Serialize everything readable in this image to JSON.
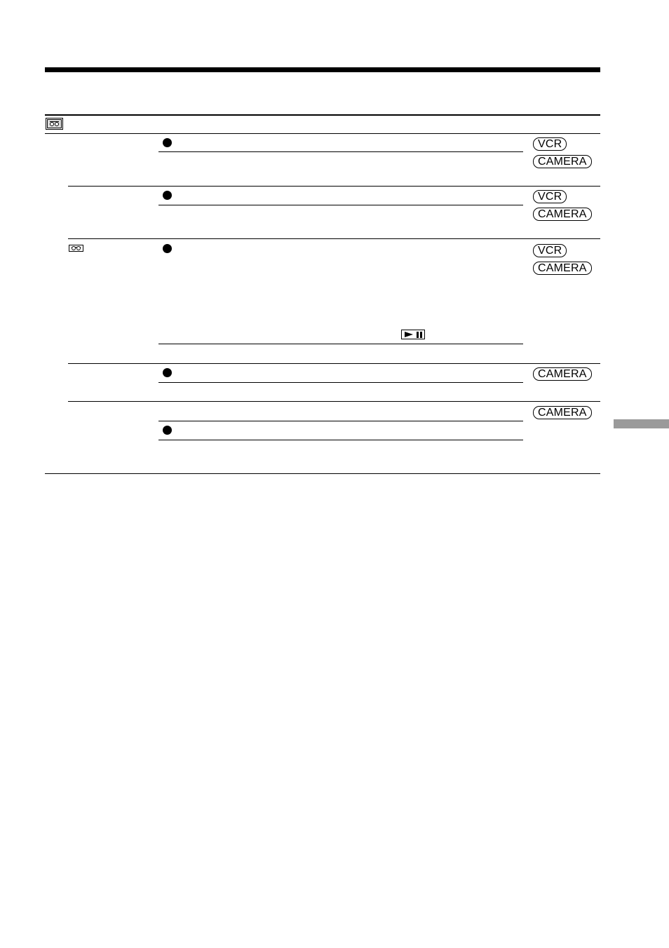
{
  "page": {
    "section_header_icon": "cassette-tape-icon",
    "side_tab": "chapter-index-tab"
  },
  "table": {
    "header": {
      "icon": "cassette-tape-icon"
    },
    "rows": [
      {
        "item_icon": null,
        "options": [
          {
            "bullet": "default-dot-icon"
          },
          {
            "bullet": null
          }
        ],
        "modes": [
          "VCR",
          "CAMERA"
        ]
      },
      {
        "item_icon": null,
        "options": [
          {
            "bullet": "default-dot-icon"
          },
          {
            "bullet": null
          }
        ],
        "modes": [
          "VCR",
          "CAMERA"
        ]
      },
      {
        "item_icon": "cassette-tape-icon",
        "options": [
          {
            "bullet": "default-dot-icon",
            "inline_icon": "play-pause-icon"
          },
          {
            "bullet": null
          }
        ],
        "modes": [
          "VCR",
          "CAMERA"
        ]
      },
      {
        "item_icon": null,
        "options": [
          {
            "bullet": "default-dot-icon"
          },
          {
            "bullet": null
          }
        ],
        "modes": [
          "CAMERA"
        ]
      },
      {
        "item_icon": null,
        "options": [
          {
            "bullet": null
          },
          {
            "bullet": "default-dot-icon"
          },
          {
            "bullet": null
          }
        ],
        "modes": [
          "CAMERA"
        ]
      }
    ]
  }
}
